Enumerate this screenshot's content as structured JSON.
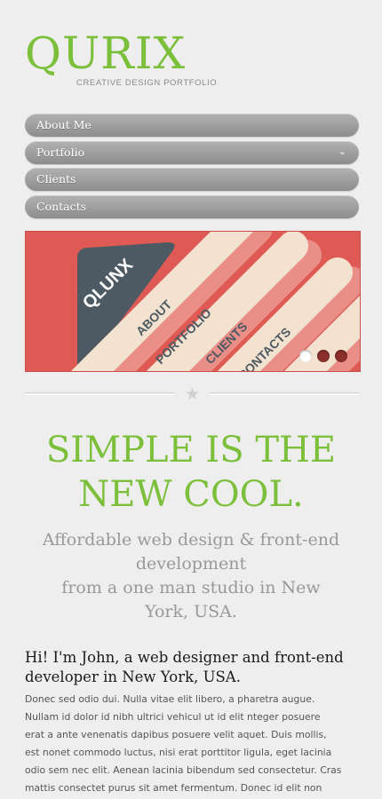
{
  "logo": {
    "title": "QURIX",
    "tagline": "CREATIVE DESIGN PORTFOLIO"
  },
  "nav": {
    "items": [
      {
        "label": "About Me"
      },
      {
        "label": "Portfolio",
        "icon": "chevron-down-icon"
      },
      {
        "label": "Clients"
      },
      {
        "label": "Contacts"
      }
    ]
  },
  "slider": {
    "brand": "QLUNX",
    "brand_small": "CREATIVE DESIGN PORTFOLIO",
    "bars": [
      "ABOUT",
      "PORTFOLIO",
      "CLIENTS",
      "CONTACTS"
    ],
    "dots_total": 3,
    "active_dot": 1,
    "colors": {
      "background": "#e05a55",
      "bar": "#f2e2cf",
      "card": "#4d5a63"
    }
  },
  "divider": {
    "icon": "star-icon"
  },
  "headline": {
    "line1": "SIMPLE IS THE",
    "line2": "NEW COOL."
  },
  "subline": {
    "line1": "Affordable web design & front-end",
    "line2": "development",
    "line3": "from a one man studio in New",
    "line4": "York, USA."
  },
  "intro": {
    "title_line1": "Hi! I'm John, a web designer and front-end",
    "title_line2": "developer in New York, USA.",
    "body_lines": [
      "Donec sed odio dui. Nulla vitae elit libero, a pharetra augue.",
      "Nullam id dolor id nibh ultrici vehicul ut id elit nteger posuere",
      "erat a ante venenatis dapibus posuere velit aquet. Duis mollis,",
      "est nonet commodo luctus, nisi erat porttitor ligula, eget lacinia",
      "odio sem nec elit. Aenean lacinia bibendum sed consectetur. Cras",
      "mattis consectet purus sit amet fermentum. Donec id elit non"
    ]
  },
  "colors": {
    "accent": "#7bbf3a",
    "muted": "#999999"
  }
}
